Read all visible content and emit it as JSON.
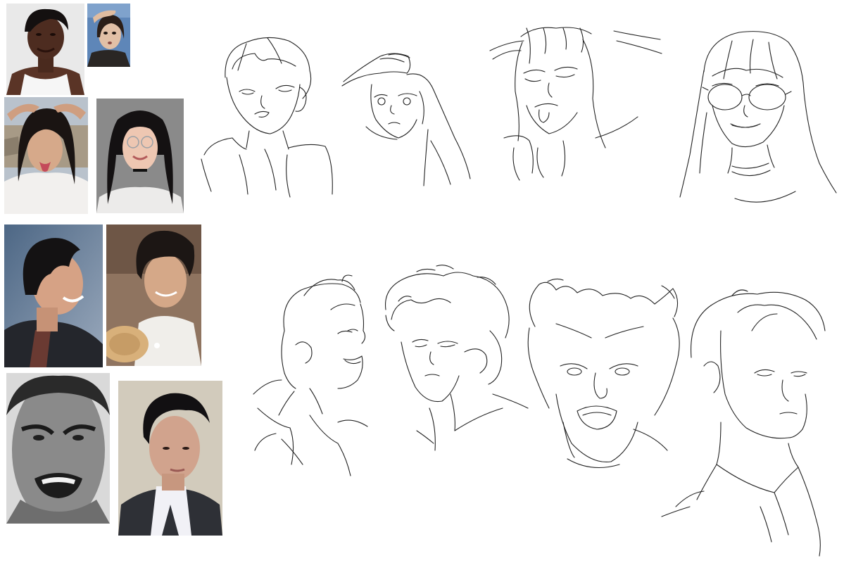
{
  "sheet": {
    "background": "#ffffff",
    "line_color": "#222222",
    "reference_photos": [
      {
        "name": "photo-woman-short-hair",
        "tone": "color"
      },
      {
        "name": "photo-woman-hand-on-head",
        "tone": "color"
      },
      {
        "name": "photo-woman-tongue-out",
        "tone": "color"
      },
      {
        "name": "photo-woman-glasses",
        "tone": "color"
      },
      {
        "name": "photo-man-smiling-profile",
        "tone": "color"
      },
      {
        "name": "photo-man-curly-hair",
        "tone": "color"
      },
      {
        "name": "photo-man-snarling",
        "tone": "grayscale"
      },
      {
        "name": "photo-young-man-vest",
        "tone": "color"
      }
    ],
    "sketches": [
      {
        "name": "sketch-woman-short-hair"
      },
      {
        "name": "sketch-woman-hand-on-head"
      },
      {
        "name": "sketch-woman-tongue-out"
      },
      {
        "name": "sketch-woman-glasses"
      },
      {
        "name": "sketch-man-smiling-profile"
      },
      {
        "name": "sketch-man-curly-hair"
      },
      {
        "name": "sketch-man-snarling"
      },
      {
        "name": "sketch-young-man-collar"
      }
    ]
  }
}
